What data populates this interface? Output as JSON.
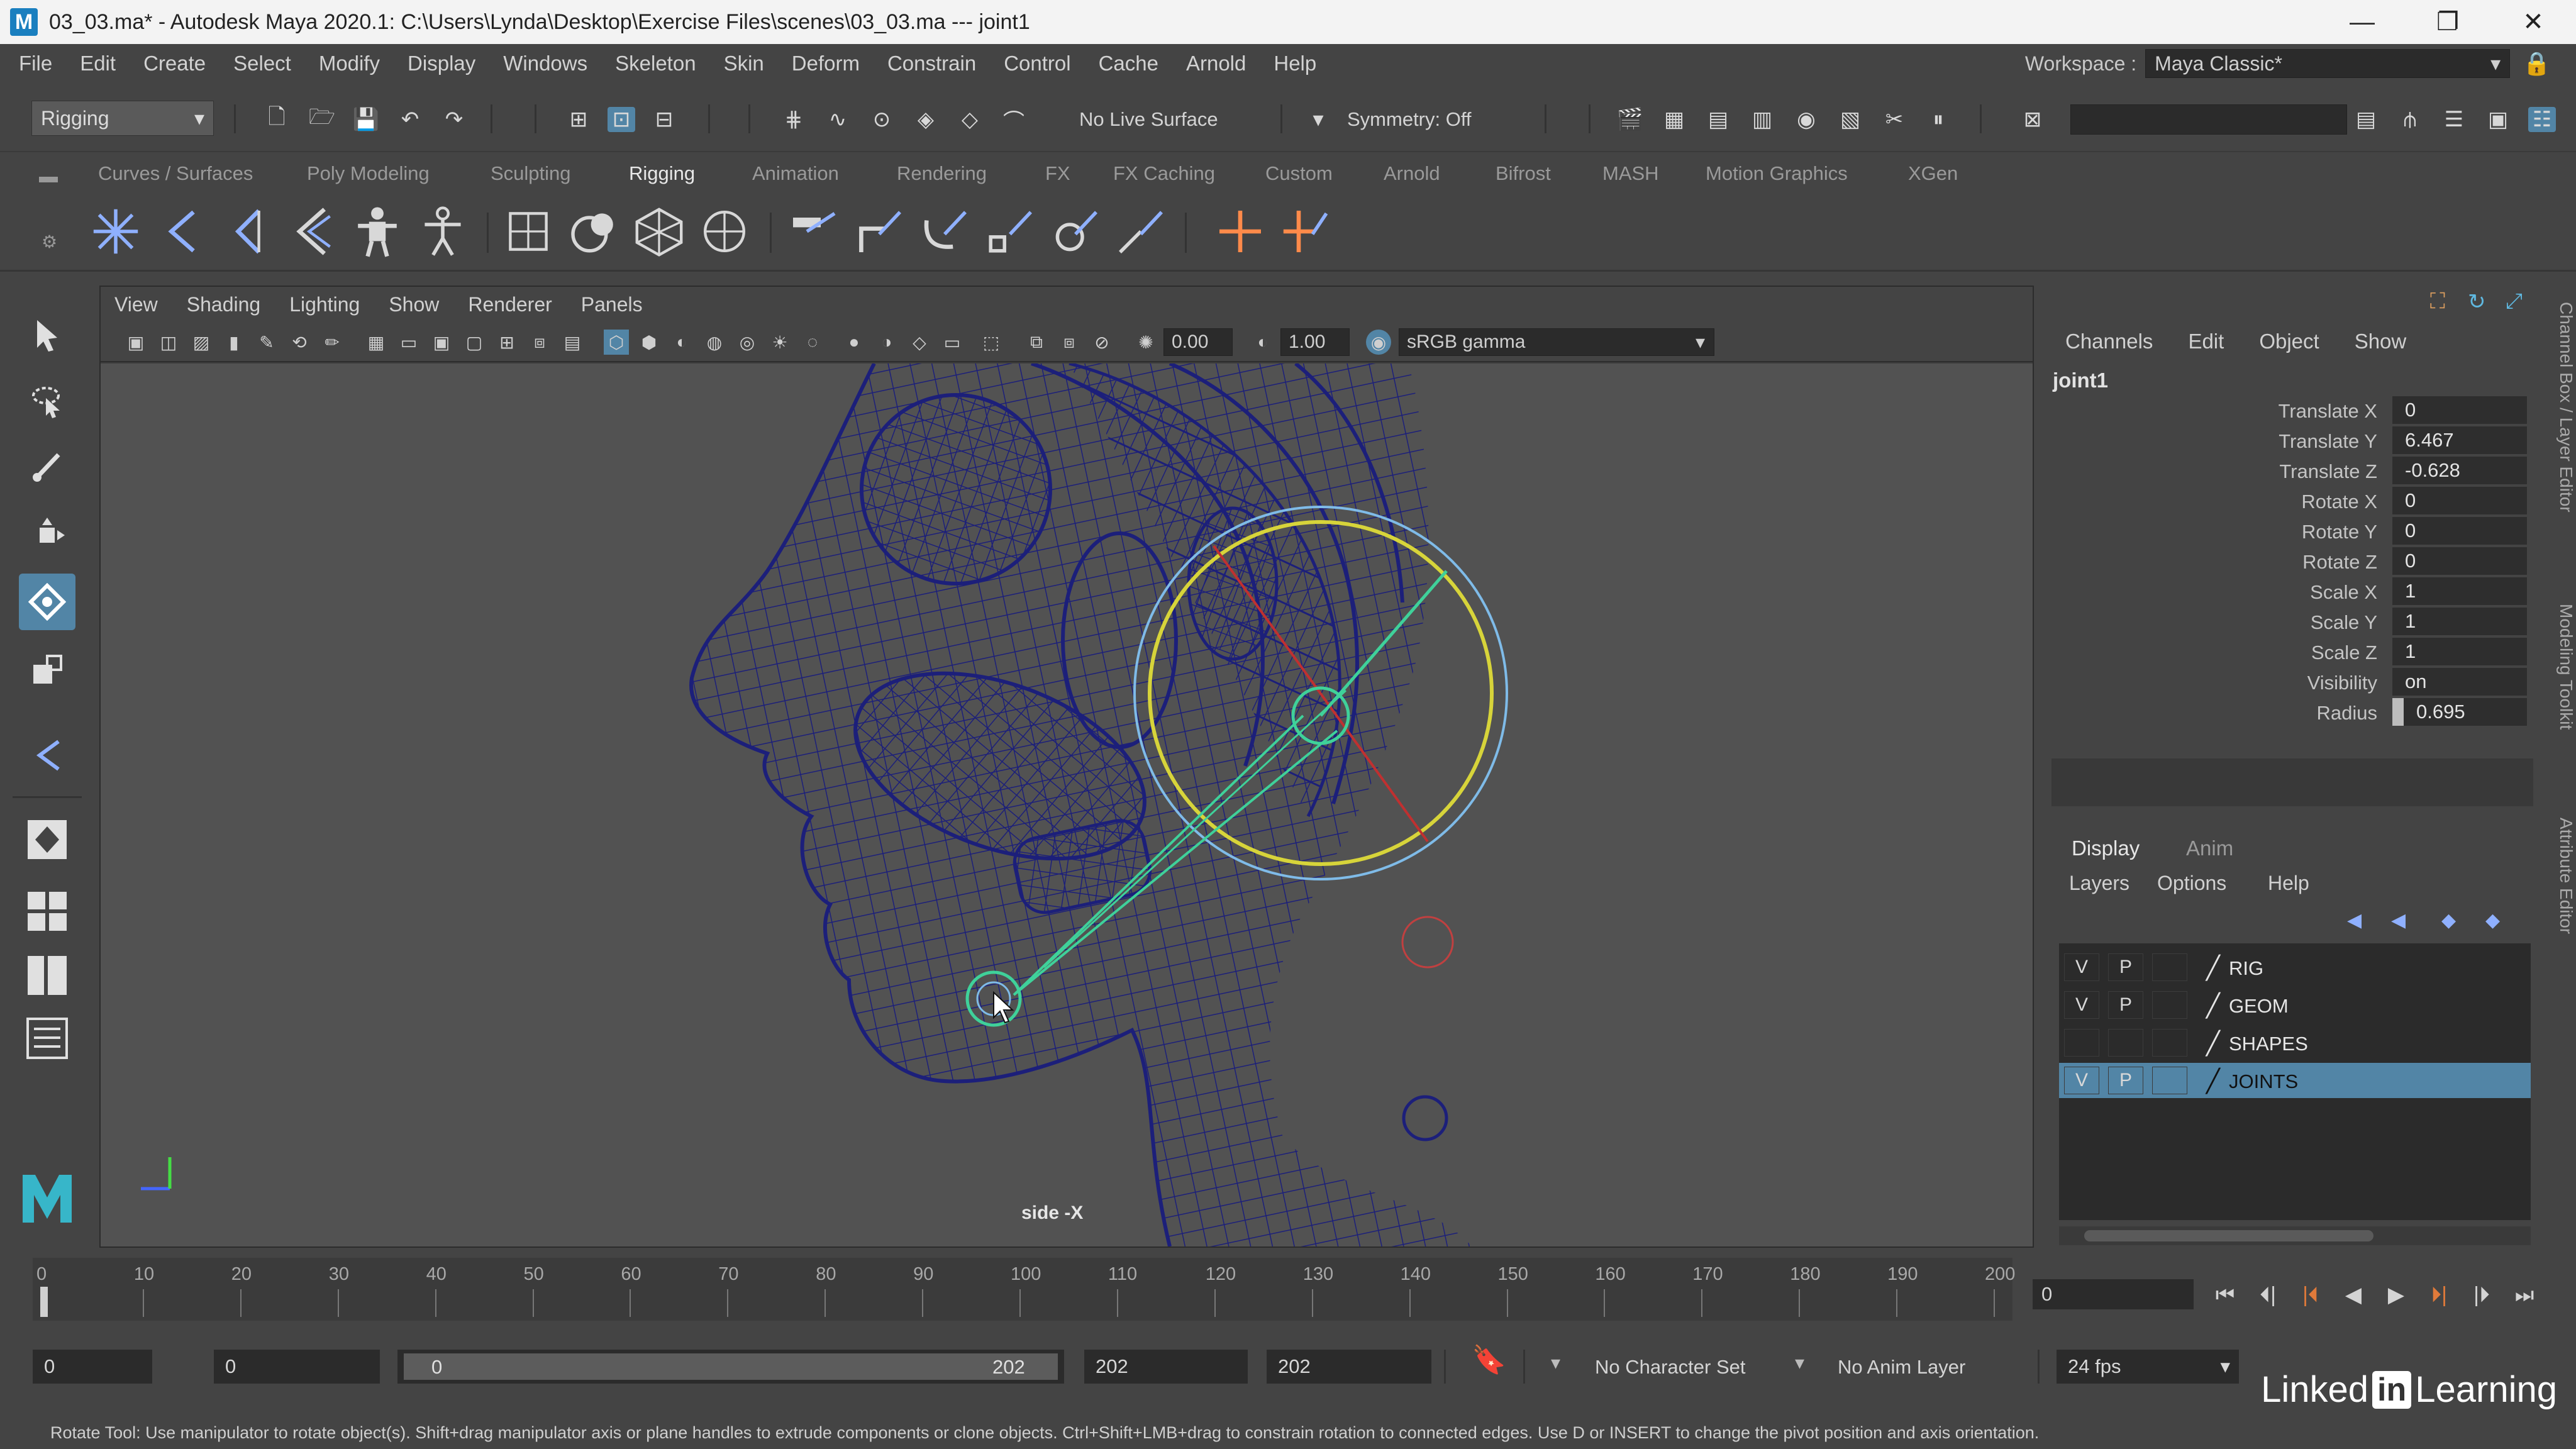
{
  "window": {
    "app_icon": "M",
    "title": "03_03.ma* - Autodesk Maya 2020.1: C:\\Users\\Lynda\\Desktop\\Exercise Files\\scenes\\03_03.ma  ---  joint1",
    "minimize": "—",
    "restore": "❐",
    "close": "✕"
  },
  "menubar": {
    "items": [
      "File",
      "Edit",
      "Create",
      "Select",
      "Modify",
      "Display",
      "Windows",
      "Skeleton",
      "Skin",
      "Deform",
      "Constrain",
      "Control",
      "Cache",
      "Arnold",
      "Help"
    ],
    "workspace_label": "Workspace :",
    "workspace_value": "Maya Classic*"
  },
  "statusline": {
    "menuset": "Rigging",
    "live_surface": "No Live Surface",
    "symmetry": "Symmetry: Off"
  },
  "shelf": {
    "tabs": [
      "Curves / Surfaces",
      "Poly Modeling",
      "Sculpting",
      "Rigging",
      "Animation",
      "Rendering",
      "FX",
      "FX Caching",
      "Custom",
      "Arnold",
      "Bifrost",
      "MASH",
      "Motion Graphics",
      "XGen"
    ],
    "active_tab": "Rigging"
  },
  "viewport": {
    "menu": [
      "View",
      "Shading",
      "Lighting",
      "Show",
      "Renderer",
      "Panels"
    ],
    "exposure": "0.00",
    "gamma": "1.00",
    "color_space": "sRGB gamma",
    "camera_label": "side -X"
  },
  "channelbox": {
    "menu": [
      "Channels",
      "Edit",
      "Object",
      "Show"
    ],
    "node": "joint1",
    "attributes": [
      {
        "label": "Translate X",
        "value": "0"
      },
      {
        "label": "Translate Y",
        "value": "6.467"
      },
      {
        "label": "Translate Z",
        "value": "-0.628"
      },
      {
        "label": "Rotate X",
        "value": "0"
      },
      {
        "label": "Rotate Y",
        "value": "0"
      },
      {
        "label": "Rotate Z",
        "value": "0"
      },
      {
        "label": "Scale X",
        "value": "1"
      },
      {
        "label": "Scale Y",
        "value": "1"
      },
      {
        "label": "Scale Z",
        "value": "1"
      },
      {
        "label": "Visibility",
        "value": "on"
      },
      {
        "label": "Radius",
        "value": "0.695"
      }
    ]
  },
  "layereditor": {
    "tabs": [
      "Display",
      "Anim"
    ],
    "menu": [
      "Layers",
      "Options",
      "Help"
    ],
    "layers": [
      {
        "v": "V",
        "p": "P",
        "name": "RIG"
      },
      {
        "v": "V",
        "p": "P",
        "name": "GEOM"
      },
      {
        "v": "",
        "p": "",
        "name": "SHAPES"
      },
      {
        "v": "V",
        "p": "P",
        "name": "JOINTS"
      }
    ]
  },
  "sidetabs": [
    "Channel Box / Layer Editor",
    "Modeling Toolkit",
    "Attribute Editor"
  ],
  "timeline": {
    "ticks": [
      "0",
      "10",
      "20",
      "30",
      "40",
      "50",
      "60",
      "70",
      "80",
      "90",
      "100",
      "110",
      "120",
      "130",
      "140",
      "150",
      "160",
      "170",
      "180",
      "190",
      "200"
    ],
    "current_frame": "0"
  },
  "range": {
    "start": "0",
    "anim_start": "0",
    "slider_start": "0",
    "slider_end": "202",
    "anim_end": "202",
    "end": "202",
    "character_set": "No Character Set",
    "anim_layer": "No Anim Layer",
    "fps": "24 fps"
  },
  "helpline": "Rotate Tool: Use manipulator to rotate object(s). Shift+drag manipulator axis or plane handles to extrude components or clone objects. Ctrl+Shift+LMB+drag to constrain rotation to connected edges. Use D or INSERT to change the pivot position and axis orientation.",
  "watermark": {
    "a": "Linked",
    "b": "in",
    "c": "Learning"
  },
  "colors": {
    "accent": "#5285a6",
    "wire": "#1c1f7a",
    "rotate_ring": "#d7d43a",
    "joint": "#3fd19a"
  }
}
